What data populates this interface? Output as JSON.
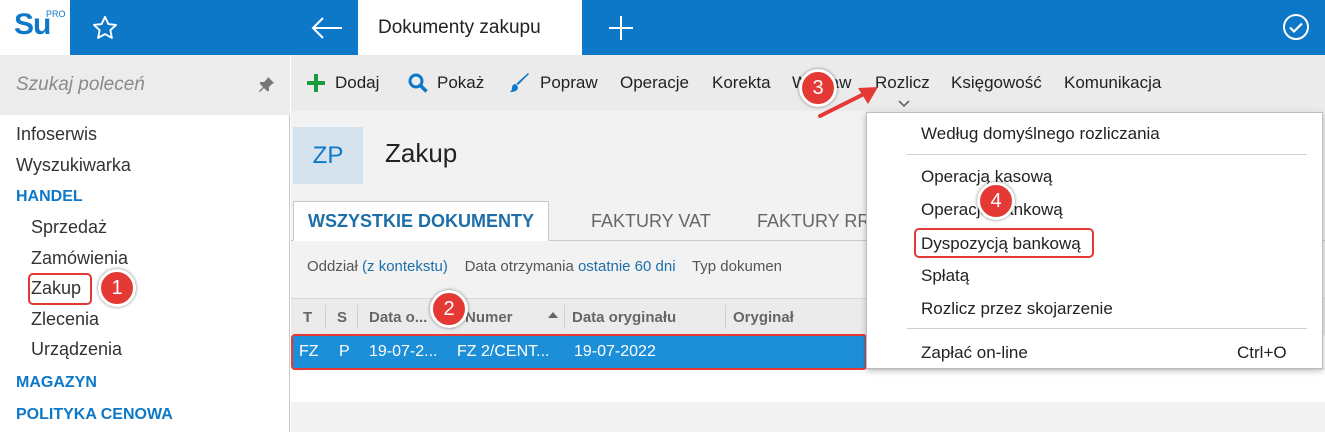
{
  "app": {
    "logo_text": "Su",
    "logo_sup": "PRO",
    "active_tab": "Dokumenty zakupu"
  },
  "sidebar": {
    "search_placeholder": "Szukaj poleceń",
    "items": [
      {
        "label": "Infoserwis",
        "type": "item"
      },
      {
        "label": "Wyszukiwarka",
        "type": "item"
      },
      {
        "label": "HANDEL",
        "type": "section"
      },
      {
        "label": "Sprzedaż",
        "type": "subitem"
      },
      {
        "label": "Zamówienia",
        "type": "subitem"
      },
      {
        "label": "Zakup",
        "type": "subitem"
      },
      {
        "label": "Zlecenia",
        "type": "subitem"
      },
      {
        "label": "Urządzenia",
        "type": "subitem"
      },
      {
        "label": "MAGAZYN",
        "type": "section"
      },
      {
        "label": "POLITYKA CENOWA",
        "type": "section"
      }
    ]
  },
  "toolbar": {
    "items": [
      "Dodaj",
      "Pokaż",
      "Popraw",
      "Operacje",
      "Korekta",
      "Wystaw",
      "Rozlicz",
      "Księgowość",
      "Komunikacja"
    ]
  },
  "document": {
    "badge": "ZP",
    "title": "Zakup"
  },
  "tabs": [
    "WSZYSTKIE DOKUMENTY",
    "FAKTURY VAT",
    "FAKTURY RR"
  ],
  "filters": {
    "branch_label": "Oddział",
    "branch_value": "(z kontekstu)",
    "date_label": "Data otrzymania",
    "date_value": "ostatnie 60 dni",
    "type_label": "Typ dokumen"
  },
  "grid": {
    "columns": [
      "T",
      "S",
      "Data o...",
      "Numer",
      "Data oryginału",
      "Oryginał"
    ],
    "rows": [
      [
        "FZ",
        "P",
        "19-07-2...",
        "FZ 2/CENT...",
        "19-07-2022",
        ""
      ]
    ]
  },
  "dropdown": {
    "items": [
      {
        "label": "Według domyślnego rozliczania"
      },
      {
        "label": "Operacją kasową"
      },
      {
        "label": "Operacją bankową"
      },
      {
        "label": "Dyspozycją bankową"
      },
      {
        "label": "Spłatą"
      },
      {
        "label": "Rozlicz przez skojarzenie"
      },
      {
        "label": "Zapłać on-line",
        "shortcut": "Ctrl+O"
      }
    ]
  },
  "annotations": [
    "1",
    "2",
    "3",
    "4"
  ],
  "colors": {
    "brand_blue": "#0e78c8",
    "selection_blue": "#1d8fd8",
    "annotation_red": "#e53935",
    "add_green": "#1a9c3e"
  }
}
